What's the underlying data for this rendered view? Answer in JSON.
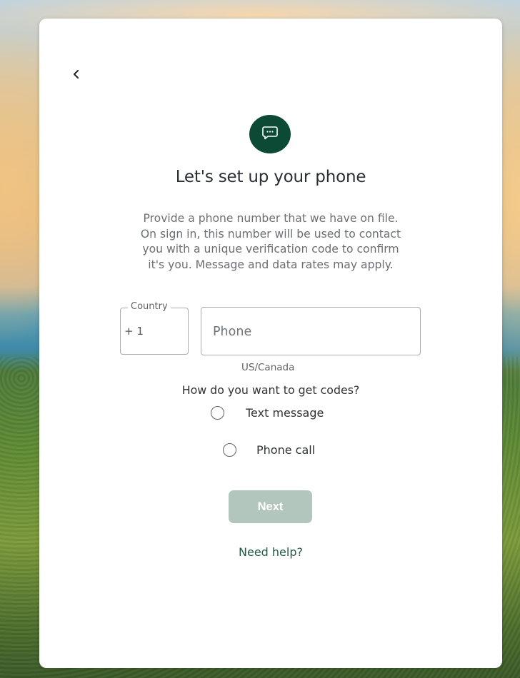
{
  "colors": {
    "brand_green": "#0d4a35",
    "button_disabled": "#b3c6be",
    "link_green": "#1f5a43"
  },
  "icons": {
    "back": "chevron-left-icon",
    "header": "chat-message-icon"
  },
  "dialog": {
    "title": "Let's set up your phone",
    "description_lines": [
      "Provide a phone number that we have on file.",
      "On sign in, this number will be used to contact",
      "you with a unique verification code to confirm",
      "it's you. Message and data rates may apply."
    ]
  },
  "form": {
    "country_label": "Country",
    "country_value": "+ 1",
    "phone_placeholder": "Phone",
    "region_hint": "US/Canada",
    "method_question": "How do you want to get codes?",
    "methods": [
      {
        "label": "Text message",
        "selected": false
      },
      {
        "label": "Phone call",
        "selected": false
      }
    ],
    "next_label": "Next",
    "next_enabled": false
  },
  "help": {
    "link_label": "Need help?"
  }
}
